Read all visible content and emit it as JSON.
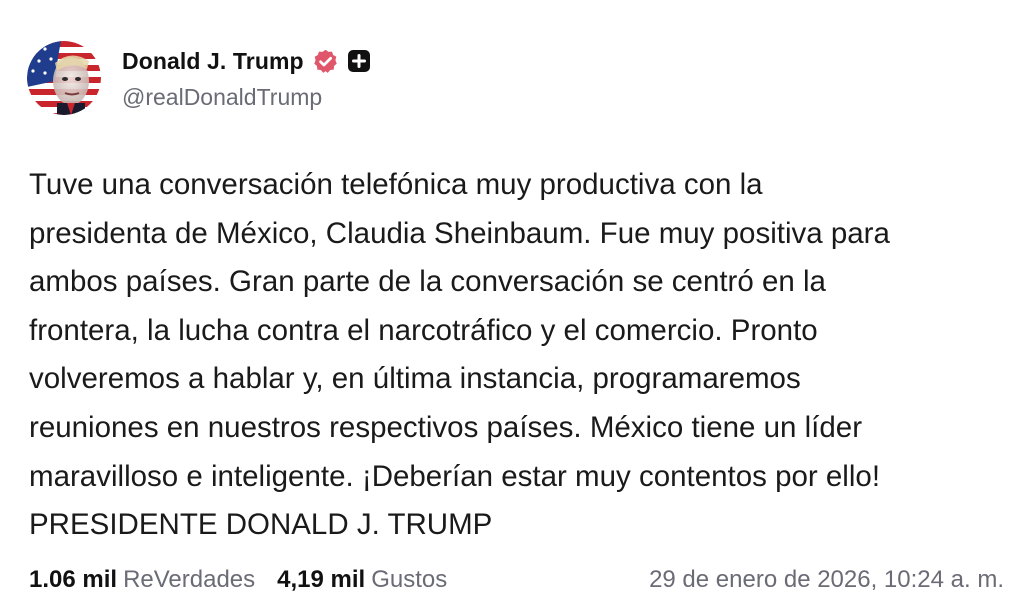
{
  "author": {
    "display_name": "Donald J. Trump",
    "handle": "@realDonaldTrump",
    "verified_icon": "verified-badge-icon",
    "extra_icon": "plus-badge-icon",
    "verified_color": "#e0566b"
  },
  "post": {
    "text": "Tuve una conversación telefónica muy productiva con la\npresidenta de México, Claudia Sheinbaum. Fue muy positiva para\nambos países. Gran parte de la conversación se centró en la\nfrontera, la lucha contra el narcotráfico y el comercio. Pronto\nvolveremos a hablar y, en última instancia, programaremos\nreuniones en nuestros respectivos países. México tiene un líder\nmaravilloso e inteligente. ¡Deberían estar muy contentos por ello!\nPRESIDENTE DONALD J. TRUMP"
  },
  "stats": {
    "reposts_count": "1.06 mil",
    "reposts_label": "ReVerdades",
    "likes_count": "4,19 mil",
    "likes_label": "Gustos"
  },
  "timestamp": "29 de enero de 2026, 10:24 a. m."
}
